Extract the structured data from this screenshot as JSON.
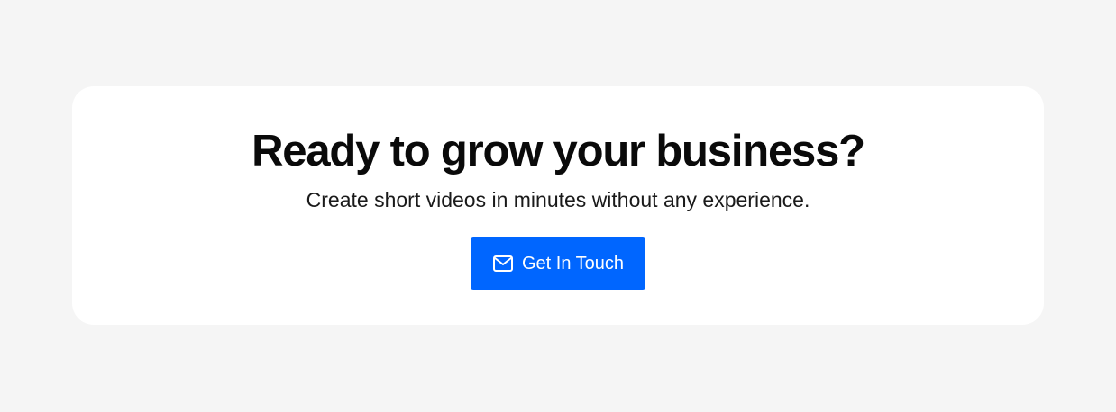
{
  "cta": {
    "title": "Ready to grow your business?",
    "subtitle": "Create short videos in minutes without any experience.",
    "button": {
      "label": "Get In Touch",
      "icon": "mail-icon"
    }
  },
  "colors": {
    "page_background": "#f5f5f5",
    "card_background": "#ffffff",
    "button_background": "#0066ff",
    "button_text": "#ffffff",
    "title_text": "#0a0a0a"
  }
}
